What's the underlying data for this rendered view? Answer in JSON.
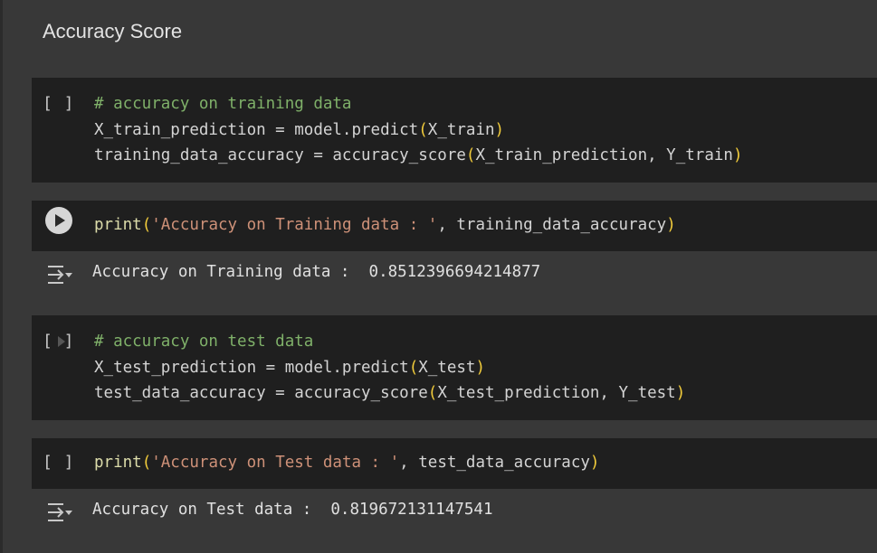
{
  "section": {
    "title": "Accuracy Score"
  },
  "cells": {
    "c1": {
      "gutter": "[ ]",
      "line1": "# accuracy on training data",
      "line2": {
        "a": "X_train_prediction = model.predict",
        "b": "(",
        "c": "X_train",
        "d": ")"
      },
      "line3": {
        "a": "training_data_accuracy = accuracy_score",
        "b": "(",
        "c": "X_train_prediction, Y_train",
        "d": ")"
      }
    },
    "c2": {
      "fn": "print",
      "open": "(",
      "str": "'Accuracy on Training data : '",
      "rest": ", training_data_accuracy",
      "close": ")",
      "output": "Accuracy on Training data :  0.8512396694214877"
    },
    "c3": {
      "gutter": "[ ]",
      "line1": "# accuracy on test data",
      "line2": {
        "a": "X_test_prediction = model.predict",
        "b": "(",
        "c": "X_test",
        "d": ")"
      },
      "line3": {
        "a": "test_data_accuracy = accuracy_score",
        "b": "(",
        "c": "X_test_prediction, Y_test",
        "d": ")"
      }
    },
    "c4": {
      "gutter": "[ ]",
      "fn": "print",
      "open": "(",
      "str": "'Accuracy on Test data : '",
      "rest": ", test_data_accuracy",
      "close": ")",
      "output": "Accuracy on Test data :  0.819672131147541"
    }
  },
  "colors": {
    "background": "#383838",
    "cell": "#1f1f1f",
    "comment": "#7fb069",
    "string": "#ce9178",
    "paren": "#f2cc3b"
  },
  "icons": {
    "run": "play-circle-icon",
    "output": "output-toggle-icon"
  }
}
